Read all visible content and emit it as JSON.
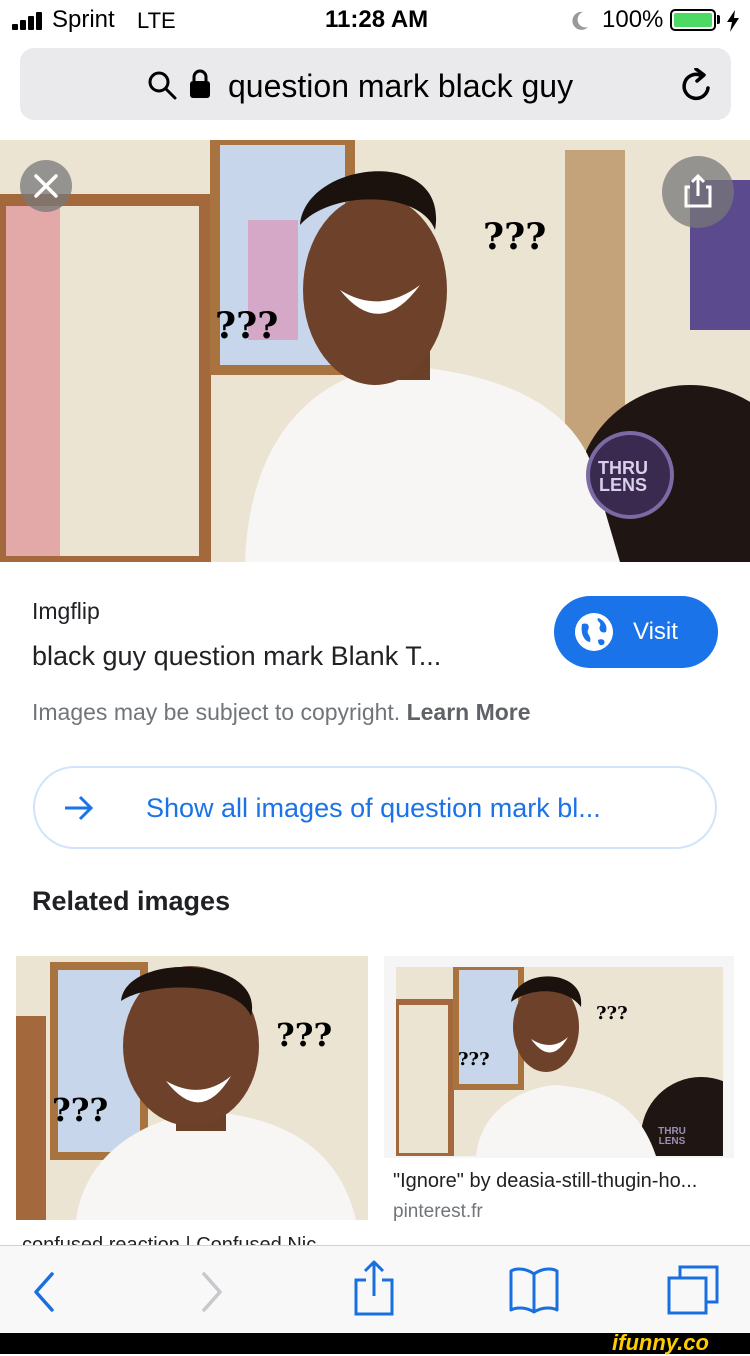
{
  "status_bar": {
    "carrier": "Sprint",
    "network": "LTE",
    "time": "11:28 AM",
    "battery_percent": "100%",
    "battery_level": 1.0,
    "icons": [
      "signal-icon",
      "moon-icon",
      "battery-icon",
      "charging-icon"
    ]
  },
  "address_bar": {
    "query": "question mark black guy",
    "icons": [
      "search-icon",
      "lock-icon",
      "reload-icon"
    ]
  },
  "hero": {
    "overlay_text_1": "???",
    "overlay_text_2": "???",
    "watermark_line1": "THRU",
    "watermark_line2": "LENS"
  },
  "result": {
    "source": "Imgflip",
    "title": "black guy question mark Blank T...",
    "visit_label": "Visit",
    "copyright_text": "Images may be subject to copyright.",
    "learn_more": "Learn More",
    "show_all": "Show all images of question mark bl..."
  },
  "related": {
    "heading": "Related images",
    "items": [
      {
        "caption": "confused reaction | Confused Nic...",
        "overlay_a": "???",
        "overlay_b": "???"
      },
      {
        "caption": "\"Ignore\" by deasia-still-thugin-ho...",
        "domain": "pinterest.fr",
        "overlay_a": "???",
        "overlay_b": "???",
        "watermark": "THRU LENS"
      }
    ]
  },
  "toolbar": {
    "icons": [
      "back-icon",
      "forward-icon",
      "share-icon",
      "bookmarks-icon",
      "tabs-icon"
    ]
  },
  "footer": {
    "brand": "ifunny.co"
  },
  "colors": {
    "accent": "#1a73e8",
    "battery": "#4cd964",
    "brand": "#ffcc00"
  }
}
